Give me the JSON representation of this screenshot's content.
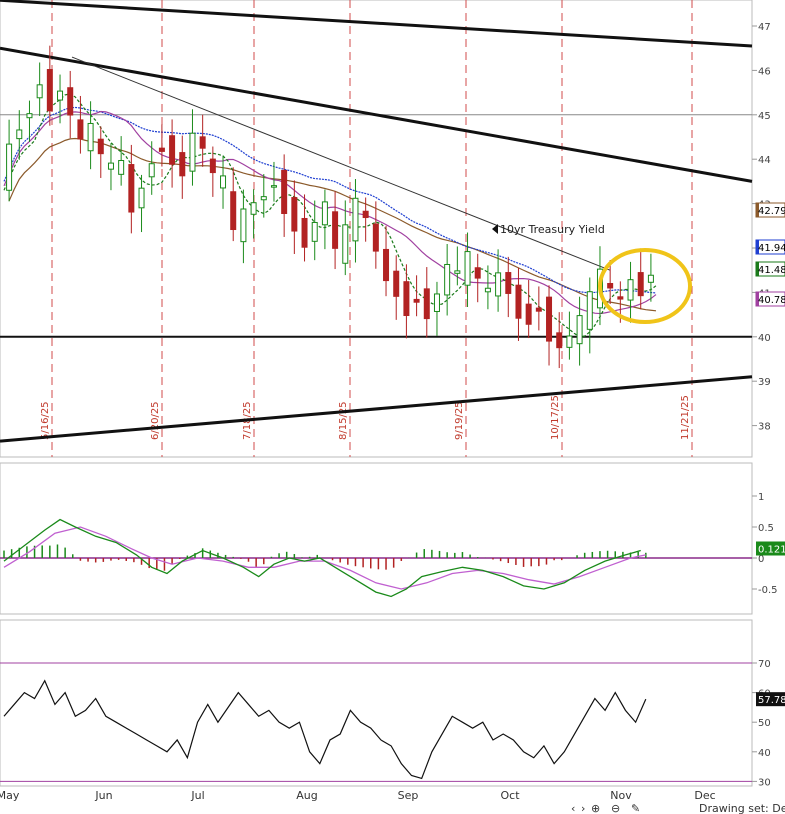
{
  "chart_data": [
    {
      "type": "candlestick",
      "panel": "price",
      "ylim": [
        37.3,
        47.5
      ],
      "y_ticks": [
        "47",
        "46",
        "45",
        "44",
        "43",
        "42",
        "41",
        "40",
        "39",
        "38"
      ],
      "x_months": [
        "May",
        "Jun",
        "Jul",
        "Aug",
        "Sep",
        "Oct",
        "Nov",
        "Dec"
      ],
      "event_dates": [
        "5/16/25",
        "6/20/25",
        "7/18/25",
        "8/15/25",
        "9/19/25",
        "10/17/25",
        "11/21/25"
      ],
      "annotation": "10yr Treasury Yield",
      "last_values": [
        {
          "value": "42.79",
          "color": "#8b5a2b"
        },
        {
          "value": "41.94",
          "color": "#1f3fd1"
        },
        {
          "value": "41.48",
          "color": "#1a7a1a"
        },
        {
          "value": "40.78",
          "color": "#a040a0"
        }
      ],
      "horizontal_levels": [
        45.0,
        40.0
      ],
      "moving_average_colors": {
        "short": "#1a7a1a",
        "medium": "#a040a0",
        "long": "#1f3fd1",
        "longest": "#8b5a2b"
      },
      "highlight_color": "#f0c419",
      "up_color": "#1a8a1a",
      "down_color": "#b22222",
      "close_path": [
        [
          0,
          43.3
        ],
        [
          5,
          44.6
        ],
        [
          10,
          44.8
        ],
        [
          16,
          45.8
        ],
        [
          20,
          45.2
        ],
        [
          24,
          45.6
        ],
        [
          28,
          45.0
        ],
        [
          32,
          44.4
        ],
        [
          36,
          44.7
        ],
        [
          40,
          44.0
        ],
        [
          44,
          43.8
        ],
        [
          48,
          43.9
        ],
        [
          52,
          42.8
        ],
        [
          56,
          43.4
        ],
        [
          60,
          44.0
        ],
        [
          64,
          44.3
        ],
        [
          68,
          44.0
        ],
        [
          72,
          43.7
        ],
        [
          76,
          44.6
        ],
        [
          80,
          44.2
        ],
        [
          84,
          43.6
        ],
        [
          88,
          43.5
        ],
        [
          92,
          42.3
        ],
        [
          96,
          42.8
        ],
        [
          100,
          43.0
        ],
        [
          104,
          43.2
        ],
        [
          108,
          43.5
        ],
        [
          112,
          42.9
        ],
        [
          116,
          42.5
        ],
        [
          120,
          42.1
        ],
        [
          124,
          42.6
        ],
        [
          128,
          43.0
        ],
        [
          132,
          41.9
        ],
        [
          136,
          42.4
        ],
        [
          140,
          43.0
        ],
        [
          144,
          42.6
        ],
        [
          148,
          41.9
        ],
        [
          152,
          41.3
        ],
        [
          156,
          41.0
        ],
        [
          160,
          40.6
        ],
        [
          164,
          40.9
        ],
        [
          168,
          40.5
        ],
        [
          172,
          41.0
        ],
        [
          176,
          41.6
        ],
        [
          180,
          41.4
        ],
        [
          184,
          41.8
        ],
        [
          188,
          41.2
        ],
        [
          192,
          41.0
        ],
        [
          196,
          41.4
        ],
        [
          200,
          41.0
        ],
        [
          204,
          40.5
        ],
        [
          208,
          40.4
        ],
        [
          212,
          40.7
        ],
        [
          216,
          40.0
        ],
        [
          220,
          39.8
        ],
        [
          224,
          40.0
        ],
        [
          228,
          40.4
        ],
        [
          232,
          40.9
        ],
        [
          236,
          41.4
        ],
        [
          240,
          41.0
        ],
        [
          244,
          40.8
        ],
        [
          248,
          41.3
        ],
        [
          252,
          41.0
        ],
        [
          256,
          41.5
        ]
      ],
      "trendlines": "descending channel, falling resistance, rising support"
    },
    {
      "type": "line",
      "panel": "macd",
      "ylim": [
        -1.2,
        1.4
      ],
      "y_ticks": [
        "1",
        "0.5",
        "0",
        "-0.5"
      ],
      "last_value": "0.121",
      "last_color": "#1a8a1a",
      "macd": [
        [
          0,
          -0.05
        ],
        [
          8,
          0.2
        ],
        [
          16,
          0.45
        ],
        [
          22,
          0.62
        ],
        [
          28,
          0.5
        ],
        [
          36,
          0.35
        ],
        [
          44,
          0.25
        ],
        [
          52,
          0.05
        ],
        [
          58,
          -0.15
        ],
        [
          64,
          -0.25
        ],
        [
          70,
          -0.05
        ],
        [
          78,
          0.12
        ],
        [
          86,
          0.0
        ],
        [
          94,
          -0.15
        ],
        [
          100,
          -0.3
        ],
        [
          106,
          -0.1
        ],
        [
          112,
          0.0
        ],
        [
          118,
          -0.05
        ],
        [
          124,
          0.0
        ],
        [
          132,
          -0.2
        ],
        [
          138,
          -0.35
        ],
        [
          146,
          -0.55
        ],
        [
          152,
          -0.62
        ],
        [
          158,
          -0.5
        ],
        [
          164,
          -0.3
        ],
        [
          172,
          -0.22
        ],
        [
          180,
          -0.15
        ],
        [
          188,
          -0.2
        ],
        [
          196,
          -0.3
        ],
        [
          204,
          -0.45
        ],
        [
          212,
          -0.5
        ],
        [
          220,
          -0.4
        ],
        [
          228,
          -0.2
        ],
        [
          236,
          -0.05
        ],
        [
          244,
          0.05
        ],
        [
          250,
          0.12
        ]
      ],
      "signal": [
        [
          0,
          -0.15
        ],
        [
          10,
          0.1
        ],
        [
          20,
          0.4
        ],
        [
          30,
          0.5
        ],
        [
          40,
          0.35
        ],
        [
          50,
          0.15
        ],
        [
          58,
          0.0
        ],
        [
          66,
          -0.1
        ],
        [
          76,
          0.0
        ],
        [
          86,
          -0.05
        ],
        [
          96,
          -0.15
        ],
        [
          106,
          -0.15
        ],
        [
          116,
          -0.05
        ],
        [
          126,
          -0.05
        ],
        [
          136,
          -0.2
        ],
        [
          146,
          -0.4
        ],
        [
          156,
          -0.5
        ],
        [
          166,
          -0.4
        ],
        [
          176,
          -0.25
        ],
        [
          186,
          -0.2
        ],
        [
          196,
          -0.25
        ],
        [
          206,
          -0.35
        ],
        [
          216,
          -0.42
        ],
        [
          226,
          -0.3
        ],
        [
          236,
          -0.15
        ],
        [
          246,
          0.0
        ],
        [
          252,
          0.05
        ]
      ]
    },
    {
      "type": "line",
      "panel": "rsi",
      "ylim": [
        28,
        76
      ],
      "y_ticks": [
        "70",
        "60",
        "50",
        "40",
        "30"
      ],
      "last_value": "57.78",
      "upper_band": 70,
      "lower_band": 30,
      "values": [
        [
          0,
          52
        ],
        [
          4,
          56
        ],
        [
          8,
          60
        ],
        [
          12,
          58
        ],
        [
          16,
          64
        ],
        [
          20,
          56
        ],
        [
          24,
          60
        ],
        [
          28,
          52
        ],
        [
          32,
          54
        ],
        [
          36,
          58
        ],
        [
          40,
          52
        ],
        [
          44,
          50
        ],
        [
          48,
          48
        ],
        [
          52,
          46
        ],
        [
          56,
          44
        ],
        [
          60,
          42
        ],
        [
          64,
          40
        ],
        [
          68,
          44
        ],
        [
          72,
          38
        ],
        [
          76,
          50
        ],
        [
          80,
          56
        ],
        [
          84,
          50
        ],
        [
          88,
          55
        ],
        [
          92,
          60
        ],
        [
          96,
          56
        ],
        [
          100,
          52
        ],
        [
          104,
          54
        ],
        [
          108,
          50
        ],
        [
          112,
          48
        ],
        [
          116,
          50
        ],
        [
          120,
          40
        ],
        [
          124,
          36
        ],
        [
          128,
          44
        ],
        [
          132,
          46
        ],
        [
          136,
          54
        ],
        [
          140,
          50
        ],
        [
          144,
          48
        ],
        [
          148,
          44
        ],
        [
          152,
          42
        ],
        [
          156,
          36
        ],
        [
          160,
          32
        ],
        [
          164,
          31
        ],
        [
          168,
          40
        ],
        [
          172,
          46
        ],
        [
          176,
          52
        ],
        [
          180,
          50
        ],
        [
          184,
          48
        ],
        [
          188,
          50
        ],
        [
          192,
          44
        ],
        [
          196,
          46
        ],
        [
          200,
          44
        ],
        [
          204,
          40
        ],
        [
          208,
          38
        ],
        [
          212,
          42
        ],
        [
          216,
          36
        ],
        [
          220,
          40
        ],
        [
          224,
          46
        ],
        [
          228,
          52
        ],
        [
          232,
          58
        ],
        [
          236,
          54
        ],
        [
          240,
          60
        ],
        [
          244,
          54
        ],
        [
          248,
          50
        ],
        [
          252,
          57.78
        ]
      ]
    }
  ],
  "footer": {
    "label": "Drawing set: Def",
    "tool_icons": [
      "scroll-left-icon",
      "scroll-right-icon",
      "zoom-in-icon",
      "zoom-out-icon",
      "pencil-icon"
    ]
  }
}
